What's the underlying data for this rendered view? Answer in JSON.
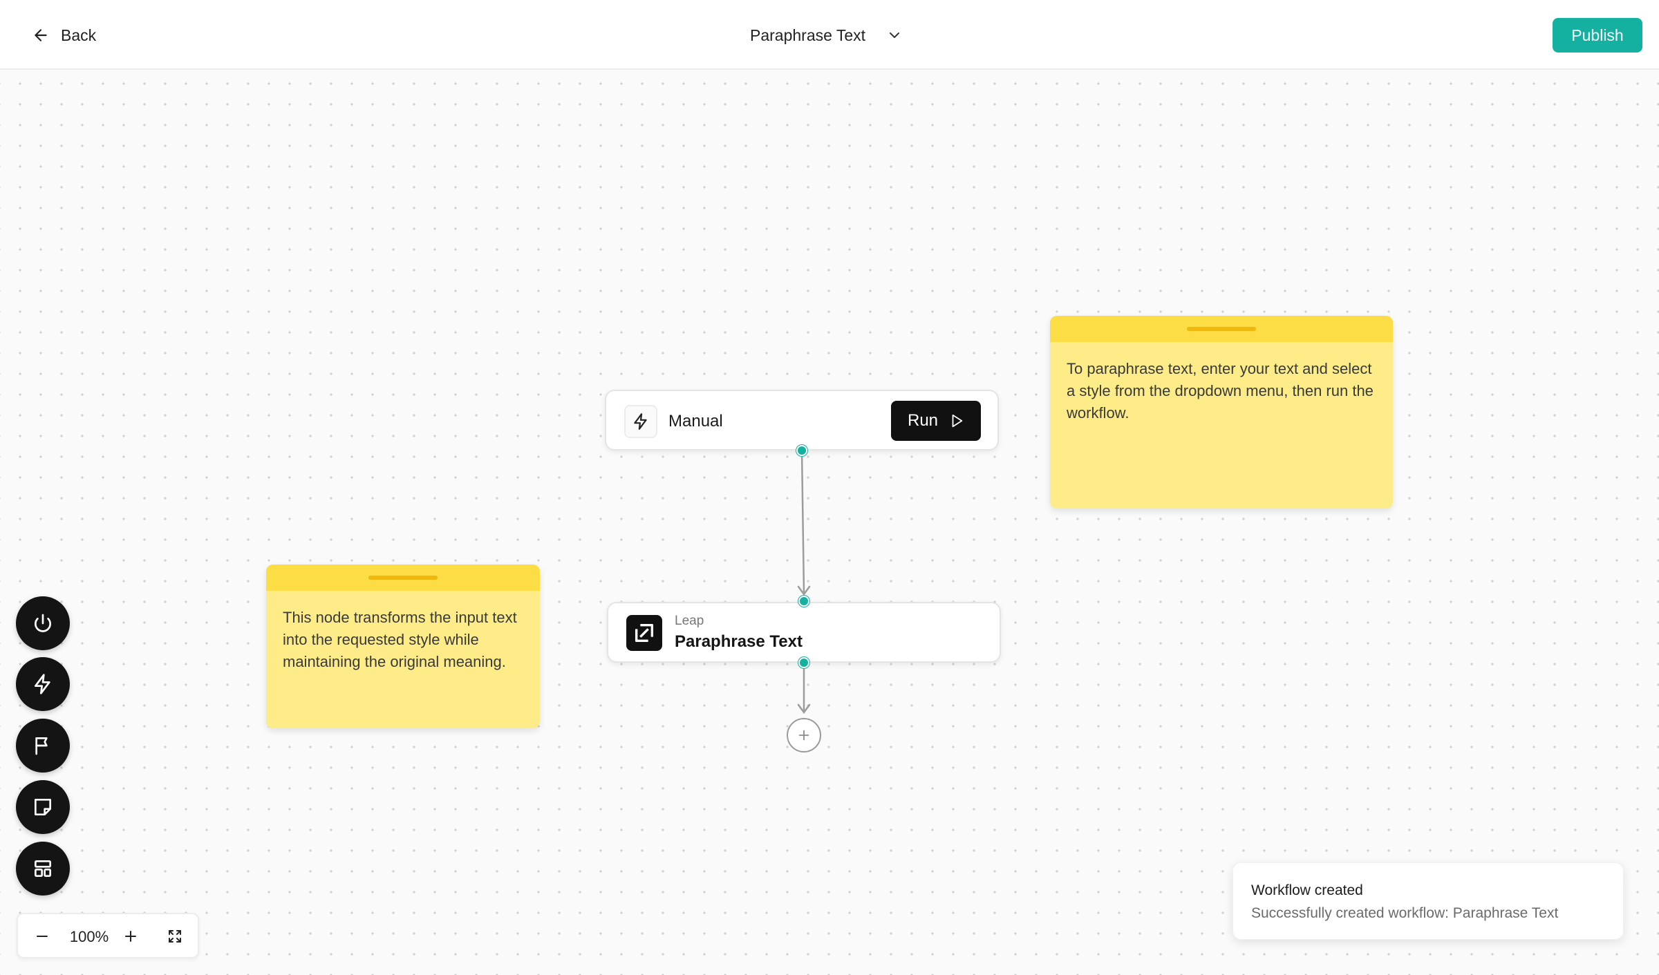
{
  "header": {
    "back_label": "Back",
    "workflow_title": "Paraphrase Text",
    "publish_label": "Publish"
  },
  "colors": {
    "accent": "#14b0a0",
    "sticky_body": "#fdec87",
    "sticky_header": "#fcdd45",
    "dark_button": "#141414"
  },
  "nodes": {
    "trigger": {
      "label": "Manual",
      "run_label": "Run",
      "icon": "lightning-icon"
    },
    "action": {
      "provider": "Leap",
      "name": "Paraphrase Text",
      "icon": "leap-logo-icon"
    }
  },
  "sticky_notes": [
    {
      "text": "This node transforms the input text into the requested style while maintaining the original meaning."
    },
    {
      "text": "To paraphrase text, enter your text and select a style from the dropdown menu, then run the workflow."
    }
  ],
  "toolbar": {
    "icons": [
      "power-icon",
      "lightning-icon",
      "flag-icon",
      "note-icon",
      "layout-icon"
    ]
  },
  "zoom": {
    "level": "100%"
  },
  "toast": {
    "title": "Workflow created",
    "message": "Successfully created workflow: Paraphrase Text"
  }
}
